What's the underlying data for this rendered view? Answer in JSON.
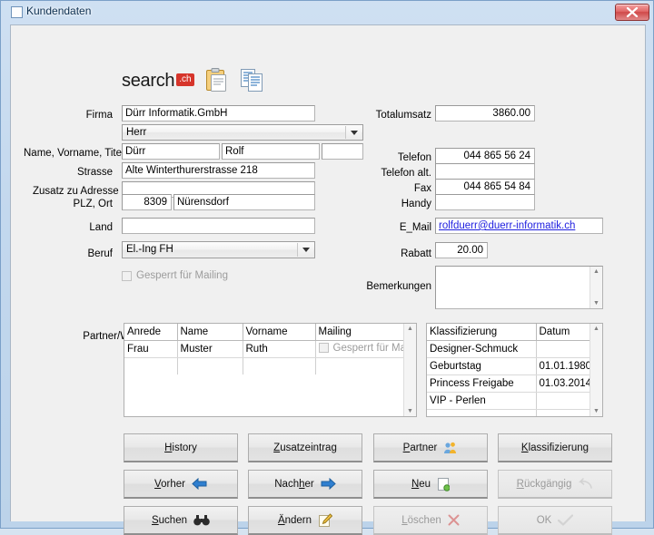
{
  "window": {
    "title": "Kundendaten",
    "close_label": "×",
    "accent_close": "#cf4848"
  },
  "logo": {
    "text": "search",
    "suffix": ".ch",
    "suffix_color": "#d6352b"
  },
  "toolbar": {
    "icons": [
      {
        "name": "clipboard-icon",
        "title": "Zwischenablage"
      },
      {
        "name": "copy-documents-icon",
        "title": "Kopieren"
      }
    ]
  },
  "form_left": {
    "firma": {
      "label": "Firma",
      "value": "Dürr Informatik.GmbH"
    },
    "anrede": {
      "value": "Herr"
    },
    "name_row": {
      "label": "Name, Vorname, Titel",
      "name": "Dürr",
      "vorname": "Rolf",
      "titel": ""
    },
    "strasse": {
      "label": "Strasse",
      "value": "Alte Winterthurerstrasse 218"
    },
    "zusatz": {
      "label": "Zusatz zu Adresse",
      "value": ""
    },
    "plz_ort": {
      "label": "PLZ, Ort",
      "plz": "8309",
      "ort": "Nürensdorf"
    },
    "land": {
      "label": "Land",
      "value": ""
    },
    "beruf": {
      "label": "Beruf",
      "value": "El.-Ing FH"
    },
    "gesperrt": {
      "label": "Gesperrt für Mailing",
      "checked": false,
      "enabled": false
    }
  },
  "form_right": {
    "totalumsatz": {
      "label": "Totalumsatz",
      "value": "3860.00"
    },
    "telefon": {
      "label": "Telefon",
      "value": "044 865 56 24"
    },
    "telefon_alt": {
      "label": "Telefon alt.",
      "value": ""
    },
    "fax": {
      "label": "Fax",
      "value": "044 865 54 84"
    },
    "handy": {
      "label": "Handy",
      "value": ""
    },
    "email": {
      "label": "E_Mail",
      "value": "rolfduerr@duerr-informatik.ch",
      "color": "#2121e0"
    },
    "rabatt": {
      "label": "Rabatt",
      "value": "20.00"
    },
    "bemerkungen": {
      "label": "Bemerkungen",
      "value": ""
    }
  },
  "partner_grid": {
    "label": "Partner/WG",
    "columns": [
      "Anrede",
      "Name",
      "Vorname",
      "Mailing"
    ],
    "rows": [
      {
        "anrede": "Frau",
        "name": "Muster",
        "vorname": "Ruth",
        "mailing_label": "Gesperrt für Mailing",
        "mailing_checked": false
      }
    ]
  },
  "klass_grid": {
    "columns": [
      "Klassifizierung",
      "Datum"
    ],
    "rows": [
      {
        "klassifizierung": "Designer-Schmuck",
        "datum": ""
      },
      {
        "klassifizierung": "Geburtstag",
        "datum": "01.01.1980"
      },
      {
        "klassifizierung": "Princess Freigabe",
        "datum": "01.03.2014"
      },
      {
        "klassifizierung": "VIP - Perlen",
        "datum": ""
      }
    ]
  },
  "buttons": [
    {
      "key": "history",
      "pre": "",
      "accel": "H",
      "post": "istory",
      "icon": "none",
      "enabled": true
    },
    {
      "key": "zusatzeintrag",
      "pre": "",
      "accel": "Z",
      "post": "usatzeintrag",
      "icon": "none",
      "enabled": true
    },
    {
      "key": "partner",
      "pre": "",
      "accel": "P",
      "post": "artner",
      "icon": "people-icon",
      "enabled": true
    },
    {
      "key": "klassifizierung",
      "pre": "",
      "accel": "K",
      "post": "lassifizierung",
      "icon": "none",
      "enabled": true
    },
    {
      "key": "vorher",
      "pre": "",
      "accel": "V",
      "post": "orher",
      "icon": "arrow-left-icon",
      "enabled": true
    },
    {
      "key": "nachher",
      "pre": "Nach",
      "accel": "h",
      "post": "er",
      "icon": "arrow-right-icon",
      "enabled": true
    },
    {
      "key": "neu",
      "pre": "",
      "accel": "N",
      "post": "eu",
      "icon": "new-page-icon",
      "enabled": true
    },
    {
      "key": "rueckgaengig",
      "pre": "",
      "accel": "R",
      "post": "ückgängig",
      "icon": "undo-icon",
      "enabled": false
    },
    {
      "key": "suchen",
      "pre": "",
      "accel": "S",
      "post": "uchen",
      "icon": "binoculars-icon",
      "enabled": true
    },
    {
      "key": "aendern",
      "pre": "",
      "accel": "Ä",
      "post": "ndern",
      "icon": "pencil-icon",
      "enabled": true
    },
    {
      "key": "loeschen",
      "pre": "",
      "accel": "L",
      "post": "öschen",
      "icon": "x-icon",
      "enabled": false
    },
    {
      "key": "ok",
      "pre": "OK",
      "accel": "",
      "post": "",
      "icon": "check-icon",
      "enabled": false
    }
  ]
}
